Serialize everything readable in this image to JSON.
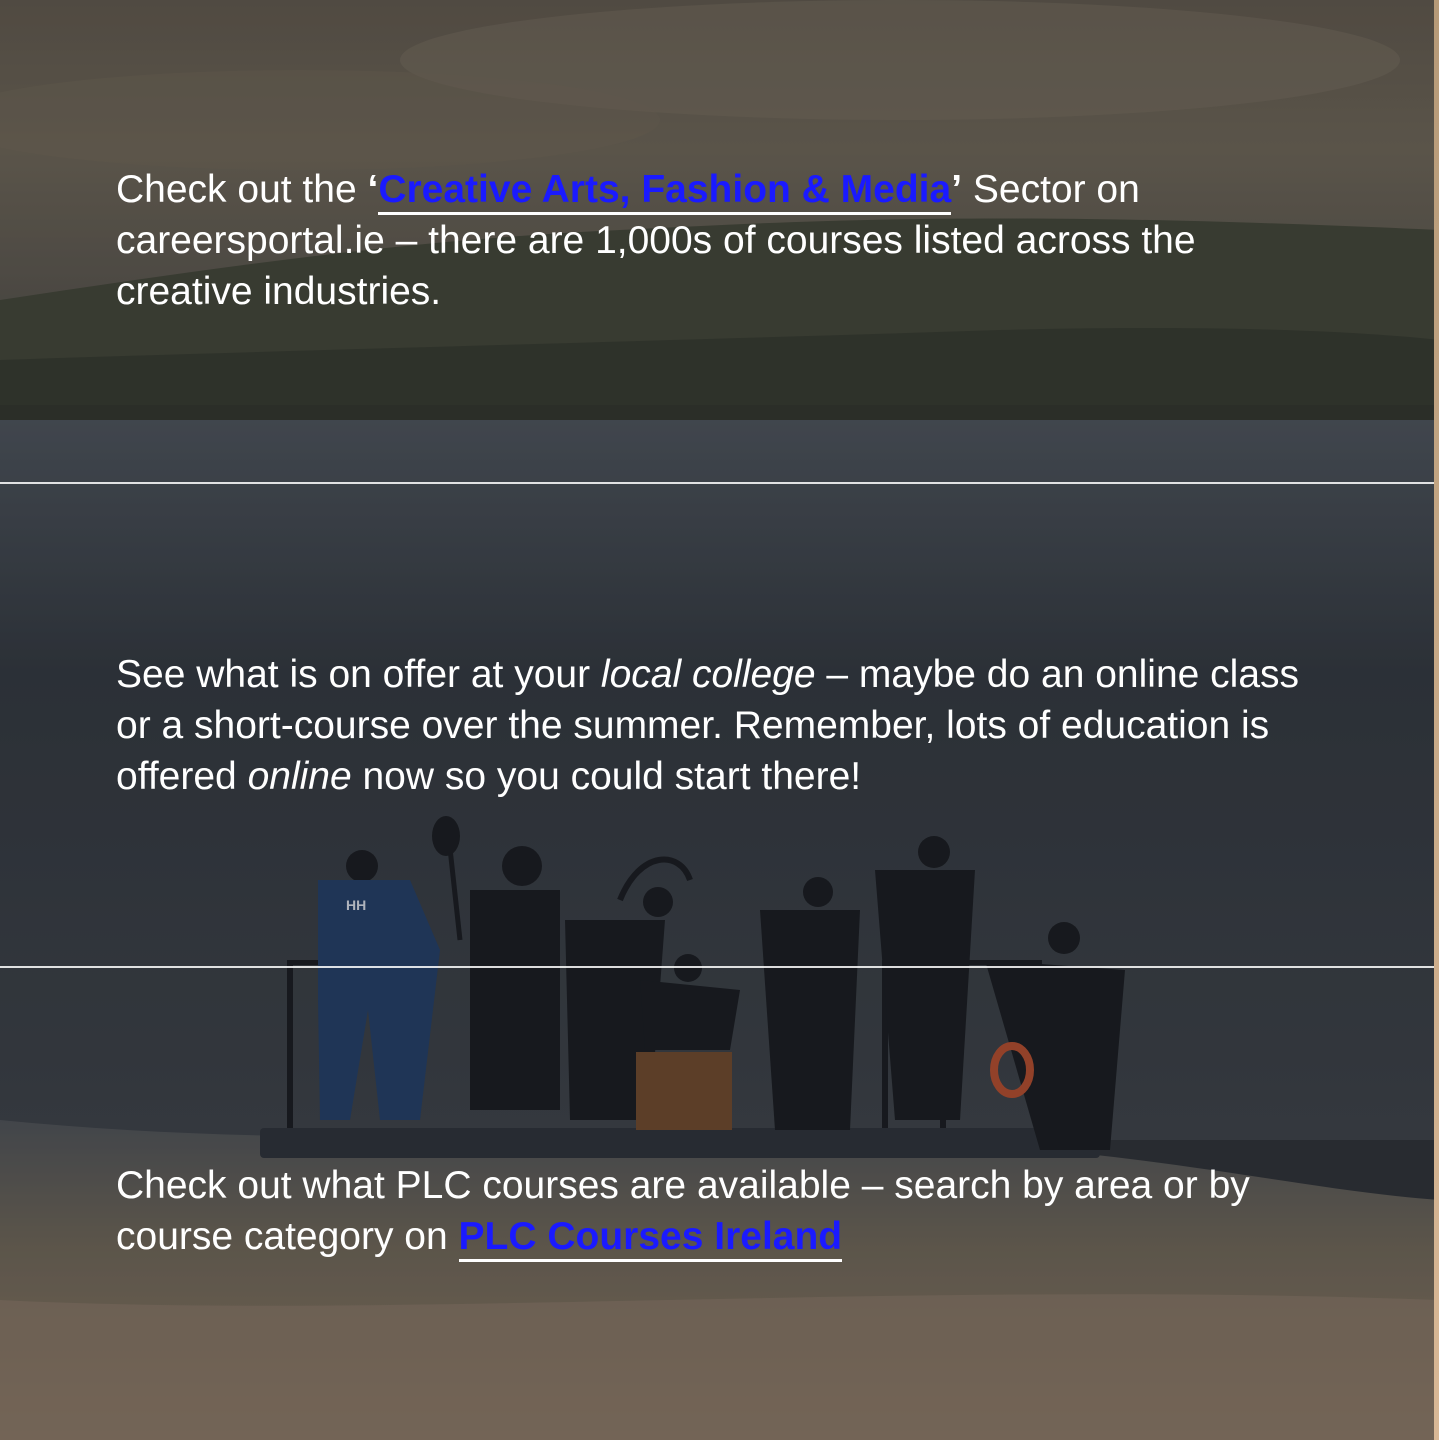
{
  "colors": {
    "link": "#1a1aff",
    "text": "#ffffff",
    "divider": "#ffffff"
  },
  "block1": {
    "prefix": "Check out the ",
    "quote_open": "‘",
    "link_text": "Creative Arts, Fashion & Media",
    "quote_close": "’",
    "suffix": " Sector on careersportal.ie – there are 1,000s of courses listed across the creative industries."
  },
  "block2": {
    "part1": "See what is on offer at your ",
    "italic1": "local college",
    "part2": " – maybe do an online class or a short-course over the summer. Remember, lots of education is offered ",
    "italic2": "online",
    "part3": " now so you could start there!"
  },
  "block3": {
    "prefix": "Check out what PLC courses are available – search by area or by course category on ",
    "link_text": "PLC Courses Ireland"
  },
  "photo": {
    "logo_text": "HH"
  }
}
